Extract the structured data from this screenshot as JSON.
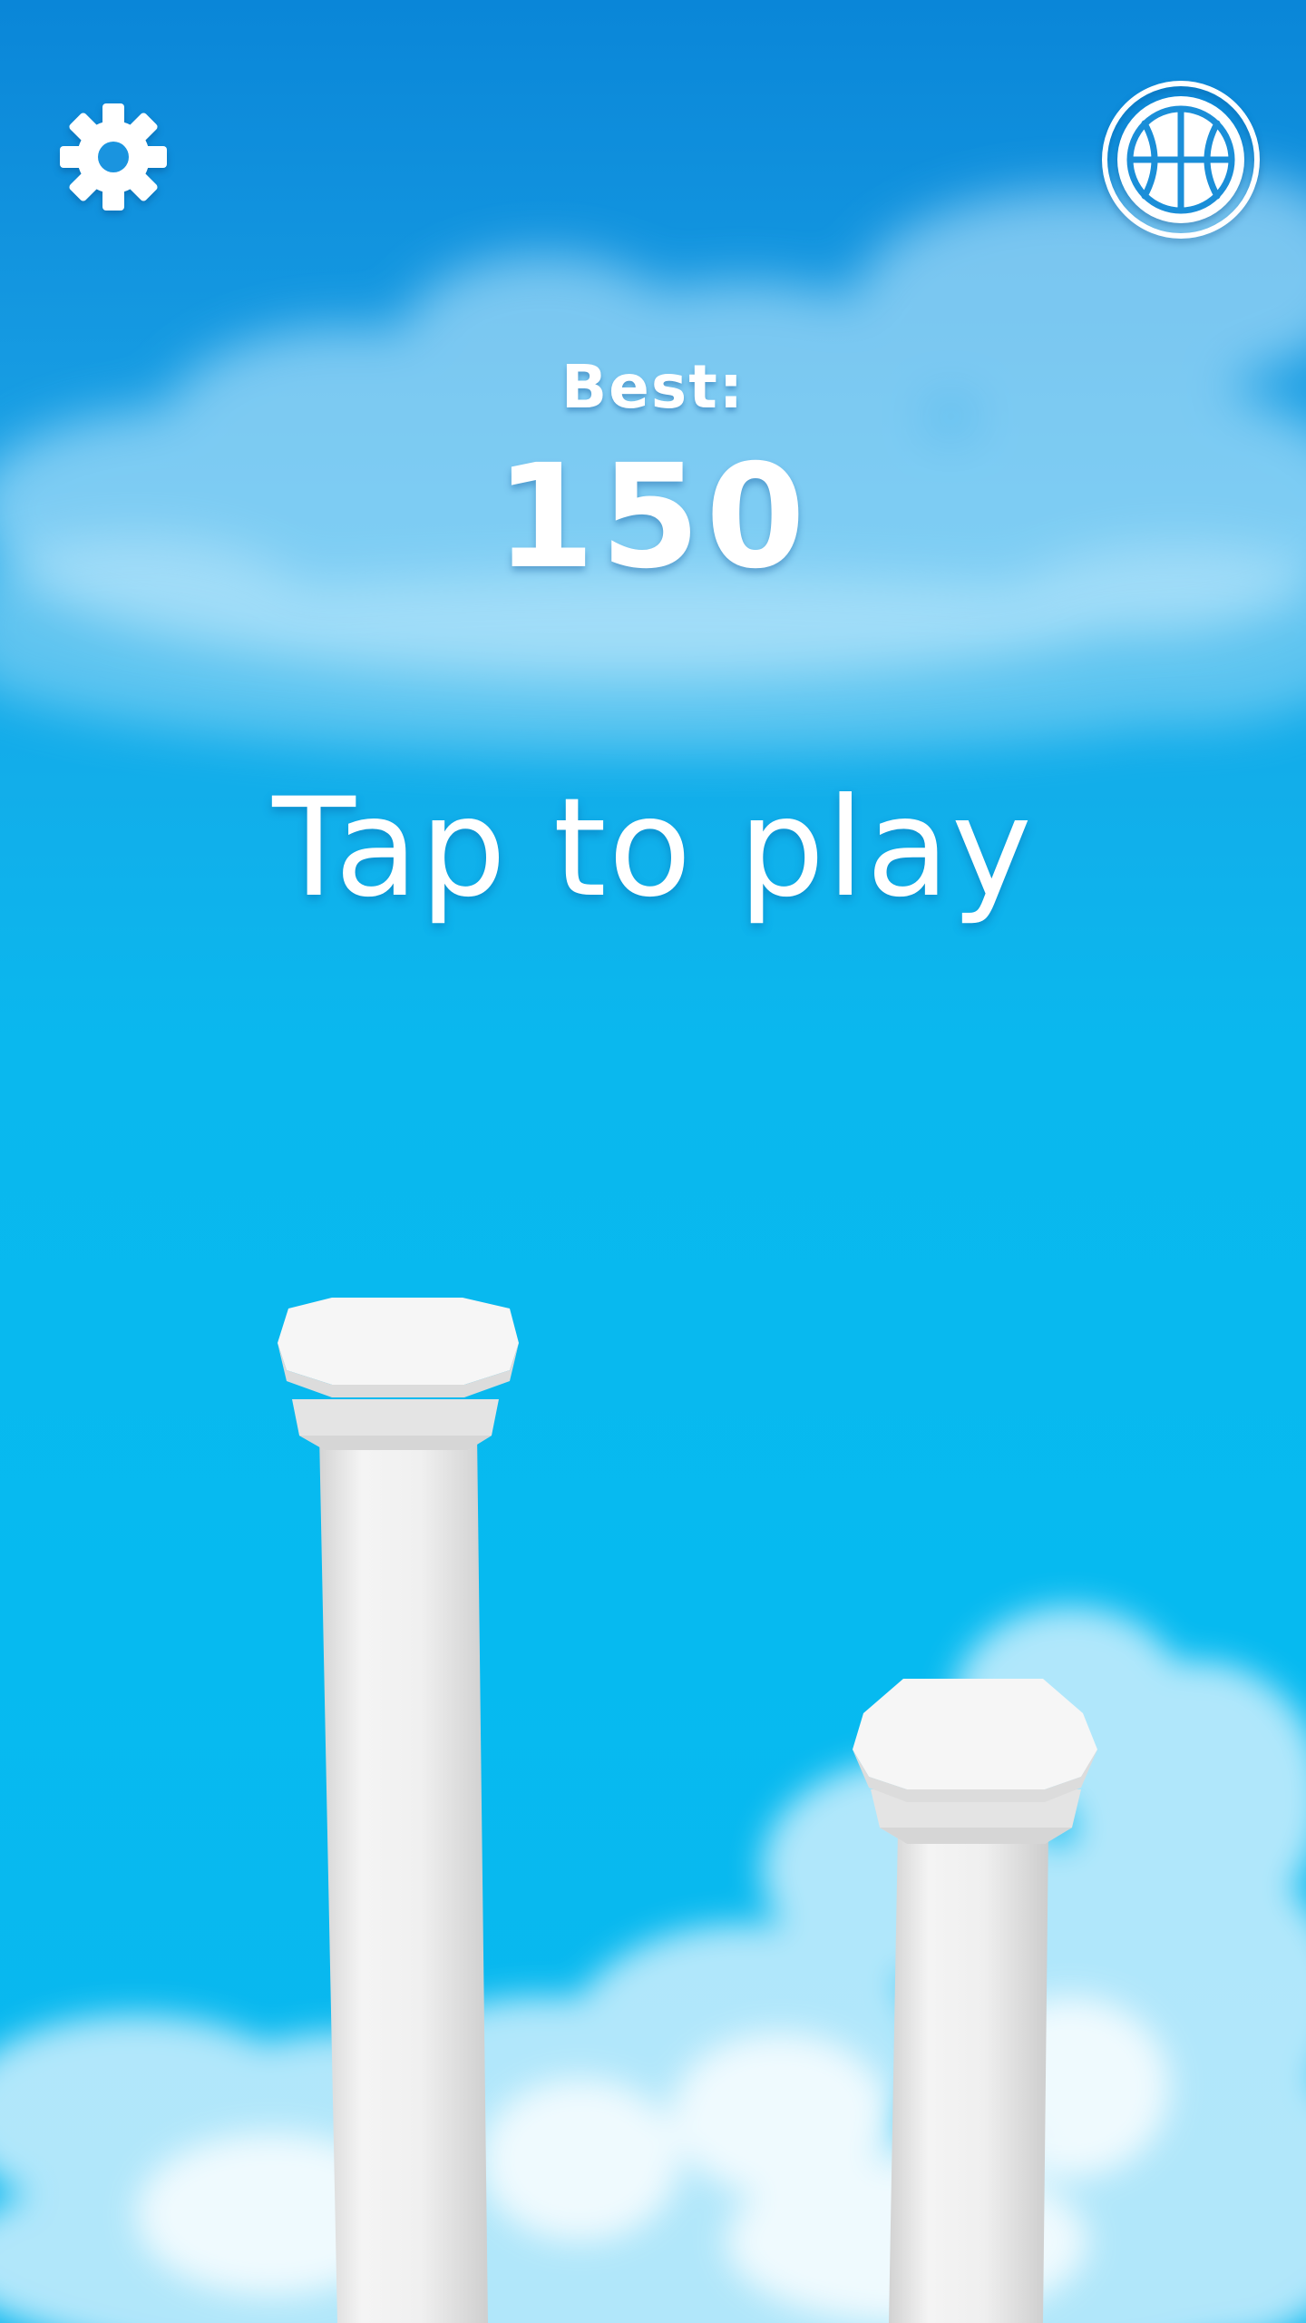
{
  "hud": {
    "settings_icon": "gear-icon",
    "ball_icon": "basketball-icon"
  },
  "score": {
    "best_label": "Best:",
    "best_value": "150"
  },
  "prompt": {
    "tap_text": "Tap to play"
  },
  "colors": {
    "sky_top": "#0a86d8",
    "sky_bottom": "#06baf0",
    "pillar": "#f3f3f3",
    "text": "#ffffff"
  }
}
